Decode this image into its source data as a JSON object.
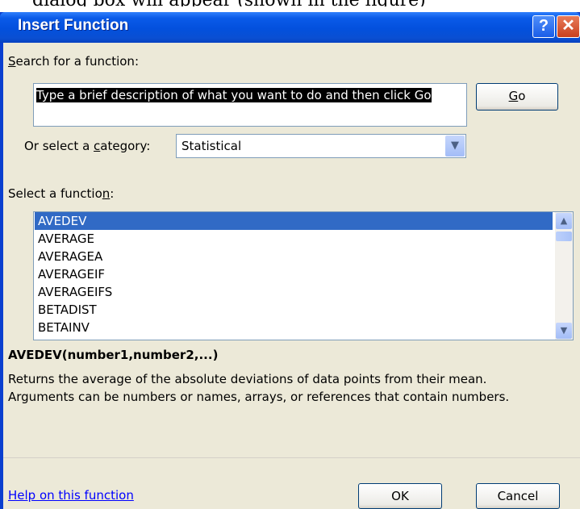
{
  "top_crop_text": "dialog box will appear (shown in the figure)",
  "window": {
    "title": "Insert Function",
    "help_glyph": "?",
    "close_glyph": "✕"
  },
  "search": {
    "label_prefix": "",
    "label_accel": "S",
    "label_rest": "earch for a function:",
    "value": "Type a brief description of what you want to do and then click Go",
    "go_accel": "G",
    "go_rest": "o"
  },
  "category": {
    "label_pre": "Or select a ",
    "label_accel": "c",
    "label_rest": "ategory:",
    "selected": "Statistical",
    "arrow_icon": "chevron-down-icon"
  },
  "function_list": {
    "label_pre": "Select a functio",
    "label_accel": "n",
    "label_rest": ":",
    "items": [
      "AVEDEV",
      "AVERAGE",
      "AVERAGEA",
      "AVERAGEIF",
      "AVERAGEIFS",
      "BETADIST",
      "BETAINV"
    ],
    "selected_index": 0
  },
  "details": {
    "signature": "AVEDEV(number1,number2,...)",
    "description": "Returns the average of the absolute deviations of data points from their mean. Arguments can be numbers or names, arrays, or references that contain numbers."
  },
  "footer": {
    "help_link": "Help on this function",
    "ok_label": "OK",
    "cancel_label": "Cancel"
  }
}
